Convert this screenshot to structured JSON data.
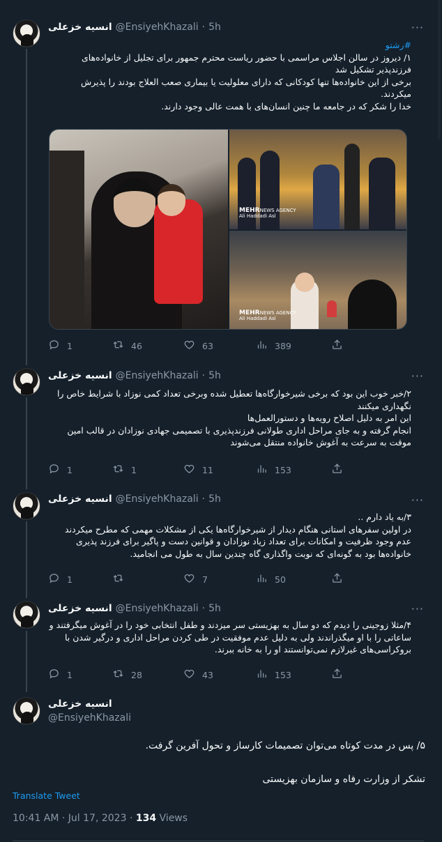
{
  "author": {
    "name": "انسیه خزعلی",
    "handle": "@EnsiyehKhazali"
  },
  "thread": [
    {
      "time": "5h",
      "hashtag": "#رشتو",
      "lines": [
        "۱/ دیروز در سالن اجلاس مراسمی با حضور ریاست محترم جمهور برای تجلیل از خانواده‌های فرزندپذیر تشکیل شد",
        "برخی از این خانواده‌ها تنها کودکانی که دارای معلولیت یا بیماری صعب العلاج بودند را پذیرش میکردند.",
        "خدا را شکر که در جامعه ما چنین انسان‌های با همت عالی وجود دارند."
      ],
      "media": {
        "watermark_brand": "MEHR",
        "watermark_agency": "NEWS AGENCY",
        "watermark_credit": "Ali Haddadi Asl"
      },
      "reply_count": "1",
      "retweet_count": "46",
      "like_count": "63",
      "view_count": "389"
    },
    {
      "time": "5h",
      "lines": [
        "۲/خبر خوب این بود که برخی شیرخوارگاه‌ها تعطیل شده وبرخی تعداد کمی نوزاد با شرایط خاص را نگهداری میکنند",
        "این امر به دلیل اصلاح رویه‌ها و دستورالعمل‌ها",
        "انجام گرفته و به جای مراحل اداری طولانی فرزندپذیری با تصمیمی جهادی نوزادان در قالب امین موقت به سرعت به آغوش خانواده منتقل می‌شوند"
      ],
      "reply_count": "1",
      "retweet_count": "1",
      "like_count": "11",
      "view_count": "153"
    },
    {
      "time": "5h",
      "lines": [
        "۳/به یاد دارم ..",
        "در اولین سفرهای استانی هنگام دیدار از شیرخوارگاه‌ها یکی از مشکلات مهمی که مطرح میکردند عدم وجود ظرفیت و امکانات برای تعداد زیاد نوزادان و قوانین دست و پاگیر برای فرزند پذیری خانواده‌ها بود به گونه‌ای که نوبت واگذاری گاه چندین سال به طول می انجامید."
      ],
      "reply_count": "1",
      "retweet_count": "",
      "like_count": "7",
      "view_count": "50"
    },
    {
      "time": "5h",
      "lines": [
        "۴/مثلا زوجینی را دیدم که دو سال به بهزیستی سر میزدند و طفل انتخابی خود را در آغوش میگرفتند و ساعاتی را با او میگذراندند ولی به دلیل عدم موفقیت در طی کردن مراحل اداری و درگیر شدن با بروکراسی‌های غیرلازم نمی‌توانستند او را به خانه ببرند."
      ],
      "reply_count": "1",
      "retweet_count": "28",
      "like_count": "43",
      "view_count": "153"
    }
  ],
  "main_tweet": {
    "line1": "۵/ پس در مدت کوتاه می‌توان تصمیمات کارساز و تحول آفرین گرفت.",
    "line2": "تشکر از وزارت رفاه و سازمان بهزیستی",
    "translate_label": "Translate Tweet",
    "timestamp": "10:41 AM · Jul 17, 2023 · ",
    "views_count": "134",
    "views_label": " Views"
  },
  "more_label": "···",
  "colors": {
    "background": "#15202b",
    "accent": "#1d9bf0",
    "muted": "#8b98a5",
    "text": "#f7f9f9"
  },
  "icons": [
    "reply-icon",
    "retweet-icon",
    "like-icon",
    "views-icon",
    "share-icon",
    "more-icon"
  ]
}
